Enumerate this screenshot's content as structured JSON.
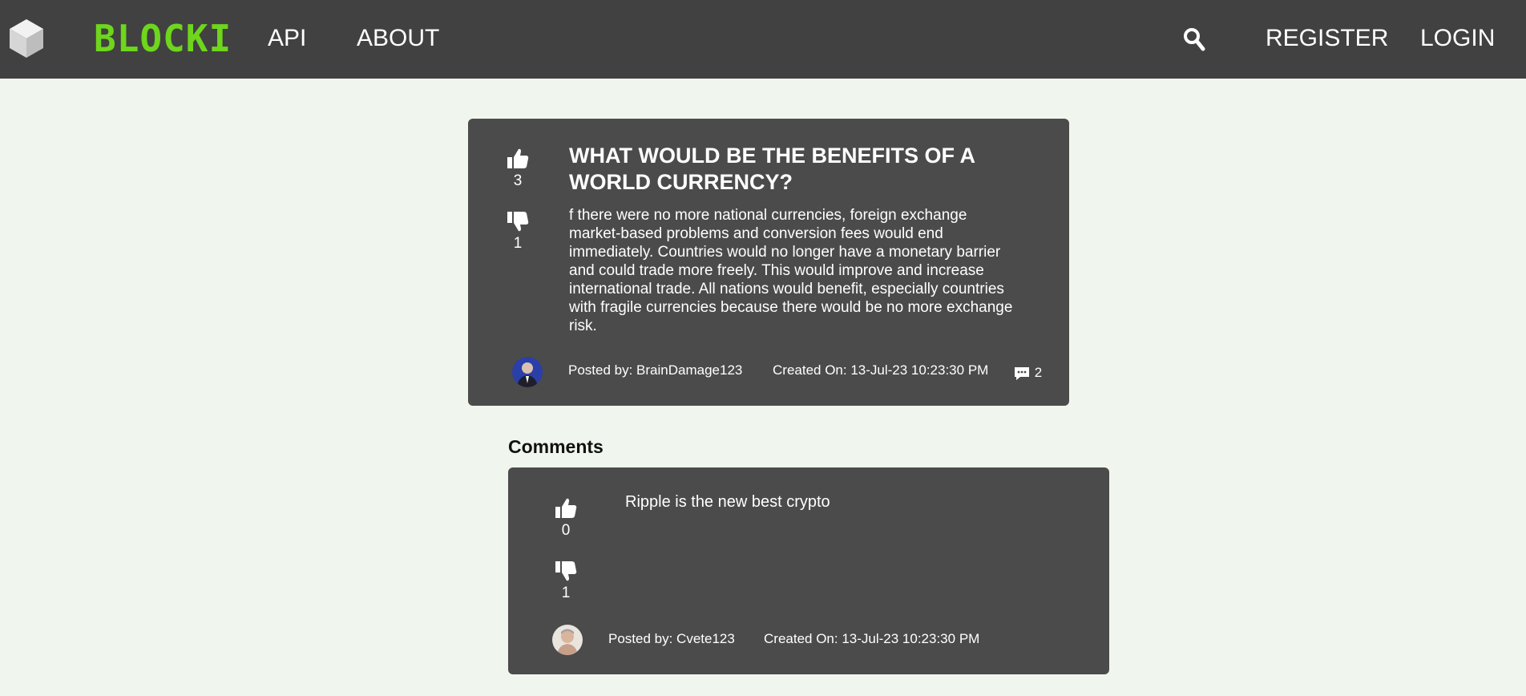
{
  "header": {
    "brand": "BLOCKI",
    "nav": {
      "api": "API",
      "about": "ABOUT"
    },
    "register": "REGISTER",
    "login": "LOGIN",
    "search_icon": "search-icon",
    "logo_icon": "cube-logo-icon"
  },
  "post": {
    "title": "WHAT WOULD BE THE BENEFITS OF A WORLD CURRENCY?",
    "body": "f there were no more national currencies, foreign exchange market-based problems and conversion fees would end immediately. Countries would no longer have a monetary barrier and could trade more freely. This would improve and increase international trade. All nations would benefit, especially countries with fragile currencies because there would be no more exchange risk.",
    "likes": "3",
    "dislikes": "1",
    "posted_by": "Posted by: BrainDamage123",
    "created_on": "Created On: 13-Jul-23 10:23:30 PM",
    "comment_count": "2"
  },
  "comments_heading": "Comments",
  "comments": [
    {
      "text": "Ripple is the new best crypto",
      "likes": "0",
      "dislikes": "1",
      "posted_by": "Posted by: Cvete123",
      "created_on": "Created On: 13-Jul-23 10:23:30 PM"
    }
  ],
  "colors": {
    "header_bg": "#414141",
    "page_bg": "#f0f6ed",
    "card_bg": "#4b4b4b",
    "brand_green": "#6ed61c"
  }
}
